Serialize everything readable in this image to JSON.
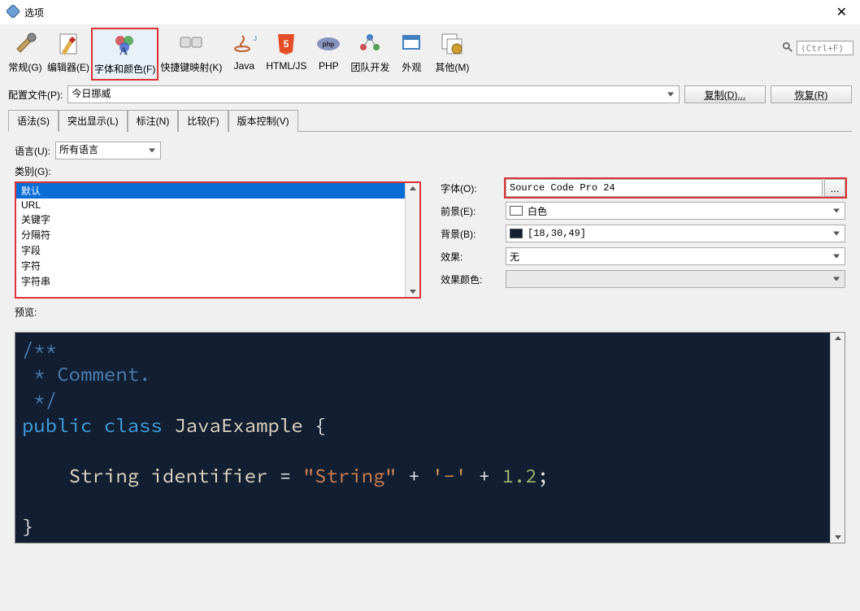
{
  "title": "选项",
  "search": {
    "placeholder": "(Ctrl+F)"
  },
  "toolbar": [
    {
      "label": "常规(G)",
      "name": "general-button"
    },
    {
      "label": "编辑器(E)",
      "name": "editor-button"
    },
    {
      "label": "字体和颜色(F)",
      "name": "fonts-colors-button"
    },
    {
      "label": "快捷键映射(K)",
      "name": "keymap-button"
    },
    {
      "label": "Java",
      "name": "java-button"
    },
    {
      "label": "HTML/JS",
      "name": "htmljs-button"
    },
    {
      "label": "PHP",
      "name": "php-button"
    },
    {
      "label": "团队开发",
      "name": "team-button"
    },
    {
      "label": "外观",
      "name": "appearance-button"
    },
    {
      "label": "其他(M)",
      "name": "other-button"
    }
  ],
  "profile": {
    "label": "配置文件(P):",
    "value": "今日挪威",
    "copy_btn": "复制(D)...",
    "restore_btn": "恢复(R)"
  },
  "tabs": [
    "语法(S)",
    "突出显示(L)",
    "标注(N)",
    "比较(F)",
    "版本控制(V)"
  ],
  "language": {
    "label": "语言(U):",
    "value": "所有语言"
  },
  "category": {
    "label": "类别(G):",
    "items": [
      "默认",
      "URL",
      "关键字",
      "分隔符",
      "字段",
      "字符",
      "字符串"
    ]
  },
  "font": {
    "label": "字体(O):",
    "value": "Source Code Pro 24",
    "ellipsis": "..."
  },
  "foreground": {
    "label": "前景(E):",
    "swatch": "#ffffff",
    "value": "白色"
  },
  "background": {
    "label": "背景(B):",
    "swatch": "#121e31",
    "value": "[18,30,49]"
  },
  "effect": {
    "label": "效果:",
    "value": "无"
  },
  "effect_color": {
    "label": "效果颜色:"
  },
  "preview_label": "预览:",
  "preview": {
    "comment1": "/**",
    "comment2": " * Comment.",
    "comment3": " */",
    "kw_public": "public",
    "kw_class": "class",
    "classname": "JavaExample",
    "brace_open": "{",
    "type_string": "String",
    "ident": "identifier",
    "eq": "=",
    "str_literal": "\"String\"",
    "plus1": "+",
    "char_literal": "'-'",
    "plus2": "+",
    "num_literal": "1.2",
    "semi": ";",
    "brace_close": "}"
  }
}
